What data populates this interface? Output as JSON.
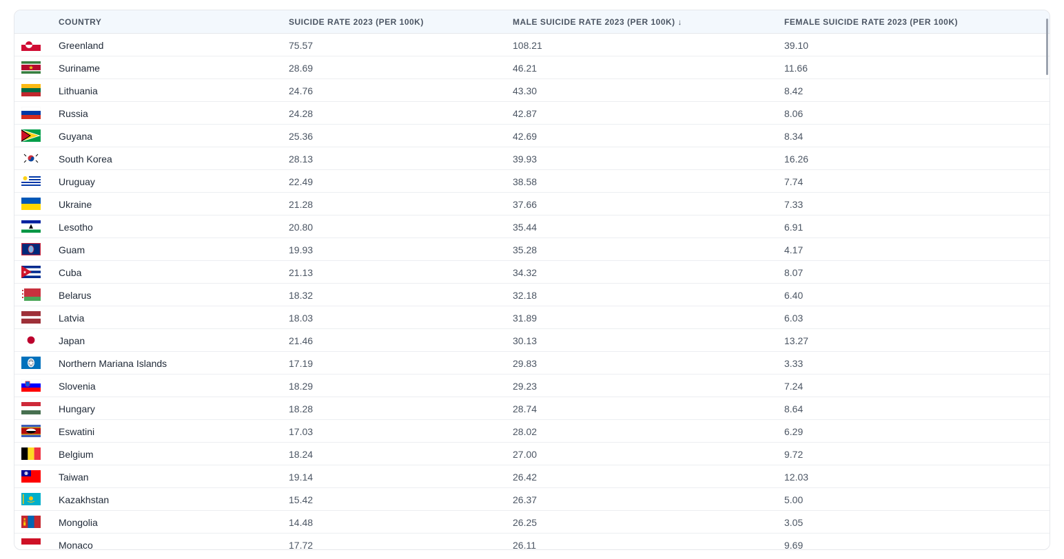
{
  "table": {
    "headers": {
      "country": "COUNTRY",
      "rate": "SUICIDE RATE 2023 (PER 100K)",
      "male": "MALE SUICIDE RATE 2023 (PER 100K) ↓",
      "female": "FEMALE SUICIDE RATE 2023 (PER 100K)"
    },
    "rows": [
      {
        "country": "Greenland",
        "rate": "75.57",
        "male": "108.21",
        "female": "39.10",
        "flag": "greenland"
      },
      {
        "country": "Suriname",
        "rate": "28.69",
        "male": "46.21",
        "female": "11.66",
        "flag": "suriname"
      },
      {
        "country": "Lithuania",
        "rate": "24.76",
        "male": "43.30",
        "female": "8.42",
        "flag": "lithuania"
      },
      {
        "country": "Russia",
        "rate": "24.28",
        "male": "42.87",
        "female": "8.06",
        "flag": "russia"
      },
      {
        "country": "Guyana",
        "rate": "25.36",
        "male": "42.69",
        "female": "8.34",
        "flag": "guyana"
      },
      {
        "country": "South Korea",
        "rate": "28.13",
        "male": "39.93",
        "female": "16.26",
        "flag": "south-korea"
      },
      {
        "country": "Uruguay",
        "rate": "22.49",
        "male": "38.58",
        "female": "7.74",
        "flag": "uruguay"
      },
      {
        "country": "Ukraine",
        "rate": "21.28",
        "male": "37.66",
        "female": "7.33",
        "flag": "ukraine"
      },
      {
        "country": "Lesotho",
        "rate": "20.80",
        "male": "35.44",
        "female": "6.91",
        "flag": "lesotho"
      },
      {
        "country": "Guam",
        "rate": "19.93",
        "male": "35.28",
        "female": "4.17",
        "flag": "guam"
      },
      {
        "country": "Cuba",
        "rate": "21.13",
        "male": "34.32",
        "female": "8.07",
        "flag": "cuba"
      },
      {
        "country": "Belarus",
        "rate": "18.32",
        "male": "32.18",
        "female": "6.40",
        "flag": "belarus"
      },
      {
        "country": "Latvia",
        "rate": "18.03",
        "male": "31.89",
        "female": "6.03",
        "flag": "latvia"
      },
      {
        "country": "Japan",
        "rate": "21.46",
        "male": "30.13",
        "female": "13.27",
        "flag": "japan"
      },
      {
        "country": "Northern Mariana Islands",
        "rate": "17.19",
        "male": "29.83",
        "female": "3.33",
        "flag": "northern-mariana-islands"
      },
      {
        "country": "Slovenia",
        "rate": "18.29",
        "male": "29.23",
        "female": "7.24",
        "flag": "slovenia"
      },
      {
        "country": "Hungary",
        "rate": "18.28",
        "male": "28.74",
        "female": "8.64",
        "flag": "hungary"
      },
      {
        "country": "Eswatini",
        "rate": "17.03",
        "male": "28.02",
        "female": "6.29",
        "flag": "eswatini"
      },
      {
        "country": "Belgium",
        "rate": "18.24",
        "male": "27.00",
        "female": "9.72",
        "flag": "belgium"
      },
      {
        "country": "Taiwan",
        "rate": "19.14",
        "male": "26.42",
        "female": "12.03",
        "flag": "taiwan"
      },
      {
        "country": "Kazakhstan",
        "rate": "15.42",
        "male": "26.37",
        "female": "5.00",
        "flag": "kazakhstan"
      },
      {
        "country": "Mongolia",
        "rate": "14.48",
        "male": "26.25",
        "female": "3.05",
        "flag": "mongolia"
      },
      {
        "country": "Monaco",
        "rate": "17.72",
        "male": "26.11",
        "female": "9.69",
        "flag": "monaco"
      }
    ]
  }
}
